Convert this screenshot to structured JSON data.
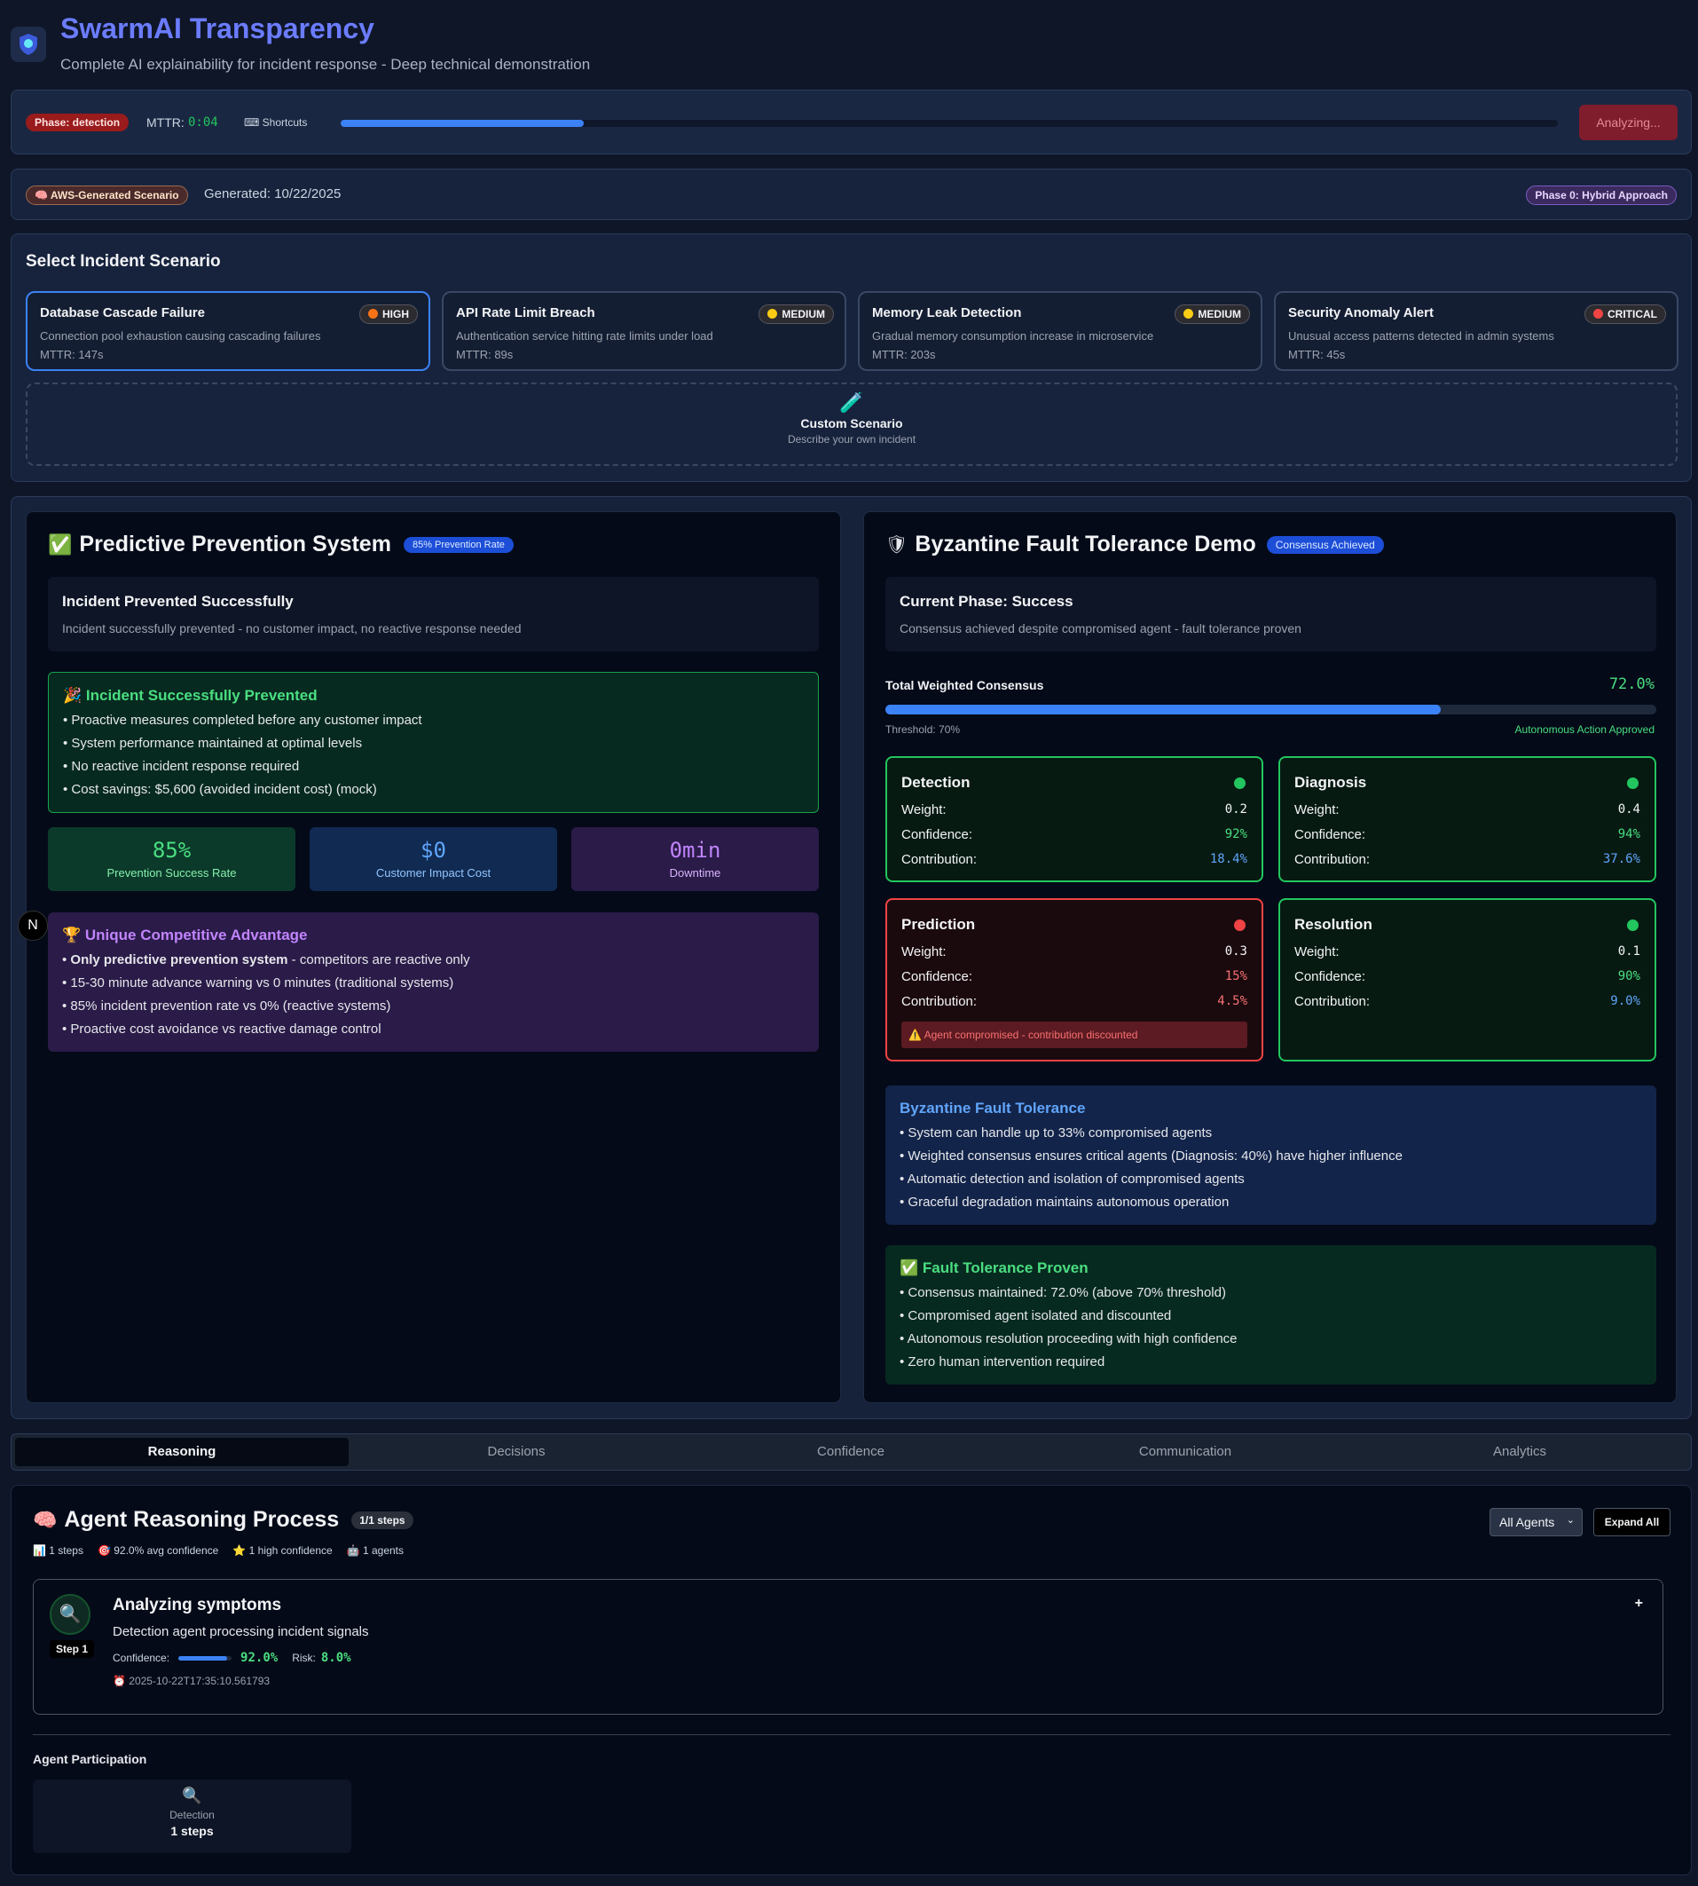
{
  "header": {
    "title": "SwarmAI Transparency",
    "subtitle": "Complete AI explainability for incident response - Deep technical demonstration"
  },
  "status": {
    "phase": "Phase: detection",
    "mttr_label": "MTTR:",
    "mttr_value": "0:04",
    "shortcuts": "⌨ Shortcuts",
    "progress": 0.2,
    "analyze_button": "Analyzing..."
  },
  "scenario_bar": {
    "badge": "🧠 AWS-Generated Scenario",
    "generated": "Generated: 10/22/2025",
    "phase_badge": "Phase 0: Hybrid Approach"
  },
  "select": {
    "title": "Select Incident Scenario",
    "custom_icon": "🧪",
    "custom_title": "Custom Scenario",
    "custom_desc": "Describe your own incident",
    "scenarios": [
      {
        "title": "Database Cascade Failure",
        "severity": "HIGH",
        "severity_color": "#f97316",
        "desc": "Connection pool exhaustion causing cascading failures",
        "mttr": "MTTR: 147s"
      },
      {
        "title": "API Rate Limit Breach",
        "severity": "MEDIUM",
        "severity_color": "#facc15",
        "desc": "Authentication service hitting rate limits under load",
        "mttr": "MTTR: 89s"
      },
      {
        "title": "Memory Leak Detection",
        "severity": "MEDIUM",
        "severity_color": "#facc15",
        "desc": "Gradual memory consumption increase in microservice",
        "mttr": "MTTR: 203s"
      },
      {
        "title": "Security Anomaly Alert",
        "severity": "CRITICAL",
        "severity_color": "#ef4444",
        "desc": "Unusual access patterns detected in admin systems",
        "mttr": "MTTR: 45s"
      }
    ]
  },
  "prevention": {
    "icon": "✅",
    "title": "Predictive Prevention System",
    "badge": "85% Prevention Rate",
    "status_title": "Incident Prevented Successfully",
    "status_desc": "Incident successfully prevented - no customer impact, no reactive response needed",
    "success_title": "🎉 Incident Successfully Prevented",
    "success_items": [
      "• Proactive measures completed before any customer impact",
      "• System performance maintained at optimal levels",
      "• No reactive incident response required",
      "• Cost savings: $5,600 (avoided incident cost) (mock)"
    ],
    "metrics": [
      {
        "value": "85%",
        "label": "Prevention Success Rate"
      },
      {
        "value": "$0",
        "label": "Customer Impact Cost"
      },
      {
        "value": "0min",
        "label": "Downtime"
      }
    ],
    "adv_title": "🏆 Unique Competitive Advantage",
    "adv_first_bold": "Only predictive prevention system",
    "adv_first_rest": " - competitors are reactive only",
    "adv_items": [
      "• 15-30 minute advance warning vs 0 minutes (traditional systems)",
      "• 85% incident prevention rate vs 0% (reactive systems)",
      "• Proactive cost avoidance vs reactive damage control"
    ]
  },
  "byzantine": {
    "icon": "🛡",
    "title": "Byzantine Fault Tolerance Demo",
    "badge": "Consensus Achieved",
    "phase_title": "Current Phase: Success",
    "phase_desc": "Consensus achieved despite compromised agent - fault tolerance proven",
    "consensus_label": "Total Weighted Consensus",
    "consensus_value": "72.0%",
    "consensus_fraction": 0.72,
    "threshold": "Threshold: 70%",
    "approved": "Autonomous Action Approved",
    "labels": {
      "weight": "Weight:",
      "confidence": "Confidence:",
      "contribution": "Contribution:"
    },
    "agents": [
      {
        "name": "Detection",
        "weight": "0.2",
        "confidence": "92%",
        "contribution": "18.4%"
      },
      {
        "name": "Diagnosis",
        "weight": "0.4",
        "confidence": "94%",
        "contribution": "37.6%"
      },
      {
        "name": "Prediction",
        "weight": "0.3",
        "confidence": "15%",
        "contribution": "4.5%",
        "warning": "⚠️ Agent compromised - contribution discounted"
      },
      {
        "name": "Resolution",
        "weight": "0.1",
        "confidence": "90%",
        "contribution": "9.0%"
      }
    ],
    "bft_title": "Byzantine Fault Tolerance",
    "bft_items": [
      "• System can handle up to 33% compromised agents",
      "• Weighted consensus ensures critical agents (Diagnosis: 40%) have higher influence",
      "• Automatic detection and isolation of compromised agents",
      "• Graceful degradation maintains autonomous operation"
    ],
    "proven_title": "✅ Fault Tolerance Proven",
    "proven_items": [
      "• Consensus maintained: 72.0% (above 70% threshold)",
      "• Compromised agent isolated and discounted",
      "• Autonomous resolution proceeding with high confidence",
      "• Zero human intervention required"
    ]
  },
  "tabs": [
    "Reasoning",
    "Decisions",
    "Confidence",
    "Communication",
    "Analytics"
  ],
  "reasoning": {
    "icon": "🧠",
    "title": "Agent Reasoning Process",
    "badge": "1/1 steps",
    "stats": [
      "📊 1 steps",
      "🎯 92.0% avg confidence",
      "⭐ 1 high confidence",
      "🤖 1 agents"
    ],
    "filter": "All Agents",
    "expand": "Expand All",
    "step": {
      "icon": "🔍",
      "label": "Step 1",
      "title": "Analyzing symptoms",
      "desc": "Detection agent processing incident signals",
      "conf_label": "Confidence:",
      "conf_value": "92.0%",
      "conf_fraction": 0.92,
      "risk_label": "Risk:",
      "risk_value": "8.0%",
      "timestamp": "⏰ 2025-10-22T17:35:10.561793",
      "toggle": "+"
    },
    "participation_title": "Agent Participation",
    "participant": {
      "icon": "🔍",
      "name": "Detection",
      "steps": "1 steps"
    }
  },
  "floating": "N"
}
